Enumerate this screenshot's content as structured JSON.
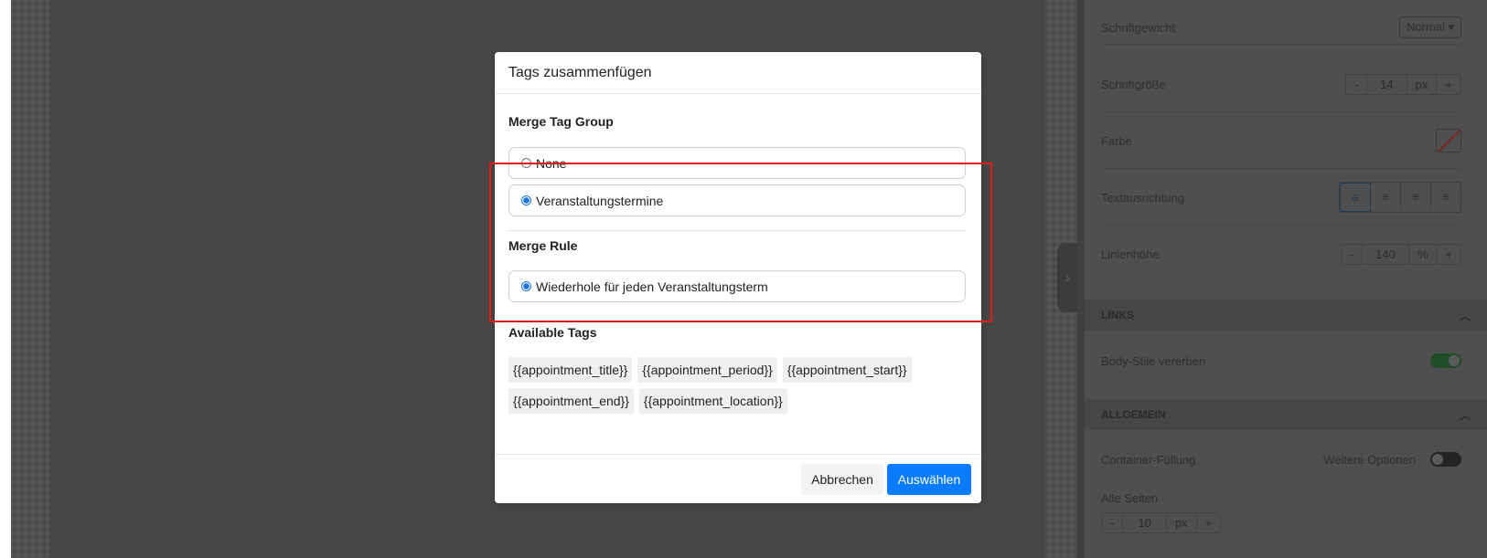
{
  "panel": {
    "font_weight_label": "Schriftgewicht",
    "font_weight_value": "Normal",
    "font_size_label": "Schriftgröße",
    "font_size_value": "14",
    "font_size_unit": "px",
    "color_label": "Farbe",
    "text_align_label": "Textausrichtung",
    "line_height_label": "Linienhöhe",
    "line_height_value": "140",
    "line_height_unit": "%",
    "minus": "-",
    "plus": "+",
    "links_section": "LINKS",
    "inherit_body_styles_label": "Body-Stile vererben",
    "general_section": "ALLGEMEIN",
    "container_padding_label": "Container-Füllung",
    "more_options_label": "Weitere Optionen",
    "all_sides_label": "Alle Seiten",
    "padding_value": "10",
    "padding_unit": "px"
  },
  "modal": {
    "title": "Tags zusammenfügen",
    "group_heading": "Merge Tag Group",
    "group_options": [
      {
        "label": "None",
        "checked": false
      },
      {
        "label": "Veranstaltungstermine",
        "checked": true
      }
    ],
    "rule_heading": "Merge Rule",
    "rule_options": [
      {
        "label": "Wiederhole für jeden Veranstaltungsterm",
        "checked": true
      }
    ],
    "tags_heading": "Available Tags",
    "tags": [
      "{{appointment_title}}",
      "{{appointment_period}}",
      "{{appointment_start}}",
      "{{appointment_end}}",
      "{{appointment_location}}"
    ],
    "cancel_label": "Abbrechen",
    "select_label": "Auswählen"
  },
  "colors": {
    "primary": "#0a7cff",
    "highlight": "#e01b1b",
    "toggle_on": "#1f4d28"
  }
}
